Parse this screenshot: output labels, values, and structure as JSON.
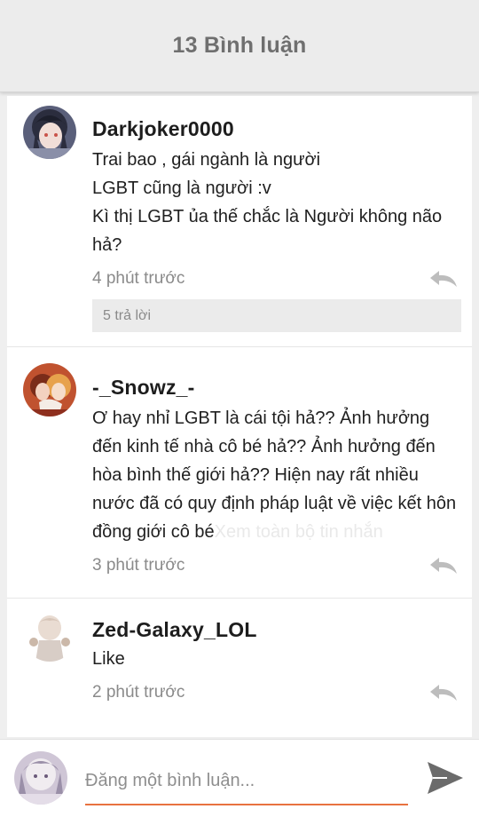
{
  "header": {
    "title": "13 Bình luận"
  },
  "comments": [
    {
      "username": "Darkjoker0000",
      "text": "Trai bao , gái ngành là người\nLGBT cũng là người :v\nKì thị LGBT ủa thế chắc là Người không não hả?",
      "time": "4 phút trước",
      "replies": "5 trả lời"
    },
    {
      "username": "-_Snowz_-",
      "text": "Ơ hay nhỉ LGBT là cái tội hả?? Ảnh hưởng đến kinh tế nhà cô bé hả?? Ảnh hưởng đến hòa bình thế giới hả?? Hiện nay rất nhiều nước đã có quy định pháp luật về việc kết hôn đồng giới cô bé",
      "more": "Xem toàn bộ tin nhắn",
      "time": "3 phút trước"
    },
    {
      "username": "Zed-Galaxy_LOL",
      "text": "Like",
      "time": "2 phút trước"
    }
  ],
  "footer": {
    "placeholder": "Đăng một bình luận..."
  },
  "colors": {
    "accent": "#e8723f",
    "header_bg": "#ececec",
    "meta_text": "#8a8a8a"
  },
  "icons": {
    "reply": "reply-arrow-icon",
    "send": "send-icon"
  }
}
